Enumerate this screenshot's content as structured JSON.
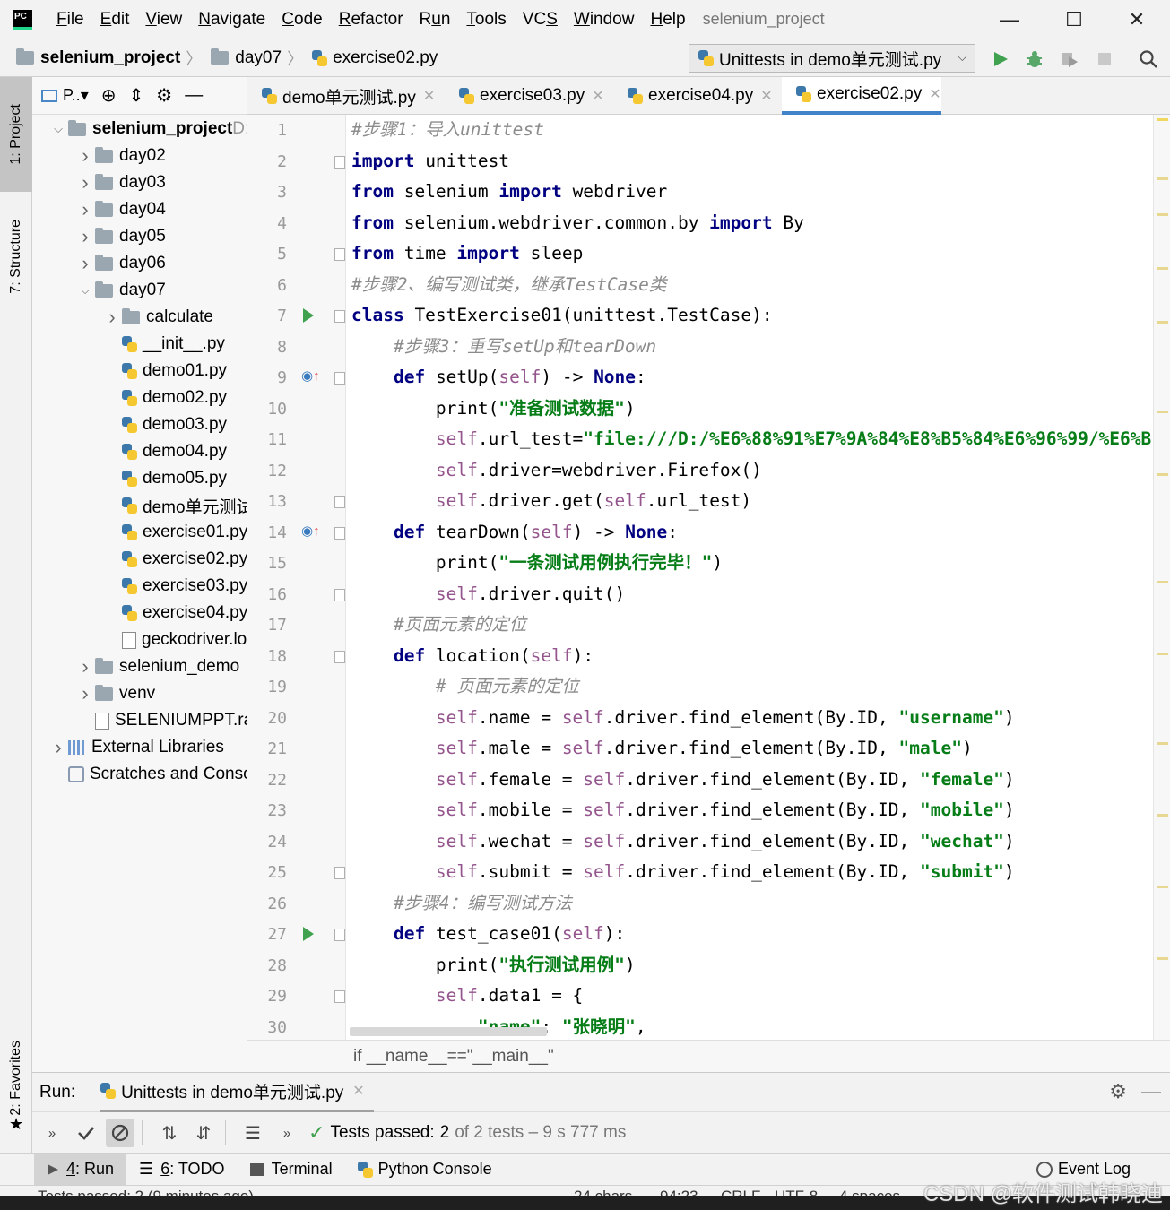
{
  "menubar": {
    "logo": "PC",
    "items": [
      "File",
      "Edit",
      "View",
      "Navigate",
      "Code",
      "Refactor",
      "Run",
      "Tools",
      "VCS",
      "Window",
      "Help"
    ],
    "mnemonics": [
      "F",
      "E",
      "V",
      "N",
      "C",
      "R",
      "u",
      "T",
      "S",
      "W",
      "H"
    ],
    "window_title": "selenium_project",
    "controls": {
      "minimize": "—",
      "maximize": "☐",
      "close": "✕"
    }
  },
  "navbar": {
    "crumbs": [
      "selenium_project",
      "day07",
      "exercise02.py"
    ],
    "run_config": "Unittests in demo单元测试.py",
    "run_config_chevron": "⌵"
  },
  "left_strip": {
    "project_tab": "1: Project",
    "structure_tab": "7: Structure",
    "favorites_tab": "2: Favorites"
  },
  "project_panel": {
    "view_label": "P..▾",
    "tree": [
      {
        "label": "selenium_project",
        "suffix": " D:",
        "type": "folder",
        "depth": 0,
        "expanded": true,
        "bold": true
      },
      {
        "label": "day02",
        "type": "folder",
        "depth": 1,
        "expanded": false
      },
      {
        "label": "day03",
        "type": "folder",
        "depth": 1,
        "expanded": false
      },
      {
        "label": "day04",
        "type": "folder",
        "depth": 1,
        "expanded": false
      },
      {
        "label": "day05",
        "type": "folder",
        "depth": 1,
        "expanded": false
      },
      {
        "label": "day06",
        "type": "folder",
        "depth": 1,
        "expanded": false
      },
      {
        "label": "day07",
        "type": "folder",
        "depth": 1,
        "expanded": true
      },
      {
        "label": "calculate",
        "type": "folder",
        "depth": 2,
        "expanded": false
      },
      {
        "label": "__init__.py",
        "type": "py",
        "depth": 2
      },
      {
        "label": "demo01.py",
        "type": "py",
        "depth": 2
      },
      {
        "label": "demo02.py",
        "type": "py",
        "depth": 2
      },
      {
        "label": "demo03.py",
        "type": "py",
        "depth": 2
      },
      {
        "label": "demo04.py",
        "type": "py",
        "depth": 2
      },
      {
        "label": "demo05.py",
        "type": "py",
        "depth": 2
      },
      {
        "label": "demo单元测试",
        "type": "py",
        "depth": 2
      },
      {
        "label": "exercise01.py",
        "type": "py",
        "depth": 2
      },
      {
        "label": "exercise02.py",
        "type": "py",
        "depth": 2
      },
      {
        "label": "exercise03.py",
        "type": "py",
        "depth": 2
      },
      {
        "label": "exercise04.py",
        "type": "py",
        "depth": 2
      },
      {
        "label": "geckodriver.lo",
        "type": "file",
        "depth": 2
      },
      {
        "label": "selenium_demo",
        "type": "folder",
        "depth": 1,
        "expanded": false
      },
      {
        "label": "venv",
        "type": "folder",
        "depth": 1,
        "expanded": false
      },
      {
        "label": "SELENIUMPPT.rar",
        "type": "file",
        "depth": 1
      },
      {
        "label": "External Libraries",
        "type": "lib",
        "depth": 0,
        "expanded": false
      },
      {
        "label": "Scratches and Consoles",
        "type": "scratch",
        "depth": 0
      }
    ]
  },
  "editor_tabs": [
    {
      "label": "demo单元测试.py",
      "active": false
    },
    {
      "label": "exercise03.py",
      "active": false
    },
    {
      "label": "exercise04.py",
      "active": false
    },
    {
      "label": "exercise02.py",
      "active": true
    }
  ],
  "editor": {
    "lines": [
      [
        [
          "cmt",
          "#步骤1：导入unittest"
        ]
      ],
      [
        [
          "kw",
          "import"
        ],
        [
          "",
          " unittest"
        ]
      ],
      [
        [
          "kw",
          "from"
        ],
        [
          "",
          " selenium "
        ],
        [
          "kw",
          "import"
        ],
        [
          "",
          " webdriver"
        ]
      ],
      [
        [
          "kw",
          "from"
        ],
        [
          "",
          " selenium.webdriver.common.by "
        ],
        [
          "kw",
          "import"
        ],
        [
          "",
          " By"
        ]
      ],
      [
        [
          "kw",
          "from"
        ],
        [
          "",
          " time "
        ],
        [
          "kw",
          "import"
        ],
        [
          "",
          " sleep"
        ]
      ],
      [
        [
          "cmt",
          "#步骤2、编写测试类，继承TestCase类"
        ]
      ],
      [
        [
          "kw",
          "class"
        ],
        [
          "",
          " TestExercise01(unittest.TestCase):"
        ]
      ],
      [
        [
          "",
          "    "
        ],
        [
          "cmt",
          "#步骤3：重写setUp和tearDown"
        ]
      ],
      [
        [
          "",
          "    "
        ],
        [
          "kw",
          "def"
        ],
        [
          "",
          " setUp("
        ],
        [
          "self",
          "self"
        ],
        [
          "",
          ") -> "
        ],
        [
          "kw",
          "None"
        ],
        [
          "",
          ":"
        ]
      ],
      [
        [
          "",
          "        print("
        ],
        [
          "str",
          "\"准备测试数据\""
        ],
        [
          "",
          ")"
        ]
      ],
      [
        [
          "",
          "        "
        ],
        [
          "self",
          "self"
        ],
        [
          "",
          ".url_test="
        ],
        [
          "str",
          "\"file:///D:/%E6%88%91%E7%9A%84%E8%B5%84%E6%96%99/%E6%B"
        ]
      ],
      [
        [
          "",
          "        "
        ],
        [
          "self",
          "self"
        ],
        [
          "",
          ".driver=webdriver.Firefox()"
        ]
      ],
      [
        [
          "",
          "        "
        ],
        [
          "self",
          "self"
        ],
        [
          "",
          ".driver.get("
        ],
        [
          "self",
          "self"
        ],
        [
          "",
          ".url_test)"
        ]
      ],
      [
        [
          "",
          "    "
        ],
        [
          "kw",
          "def"
        ],
        [
          "",
          " tearDown("
        ],
        [
          "self",
          "self"
        ],
        [
          "",
          ") -> "
        ],
        [
          "kw",
          "None"
        ],
        [
          "",
          ":"
        ]
      ],
      [
        [
          "",
          "        print("
        ],
        [
          "str",
          "\"一条测试用例执行完毕！\""
        ],
        [
          "",
          ")"
        ]
      ],
      [
        [
          "",
          "        "
        ],
        [
          "self",
          "self"
        ],
        [
          "",
          ".driver.quit()"
        ]
      ],
      [
        [
          "",
          "    "
        ],
        [
          "cmt",
          "#页面元素的定位"
        ]
      ],
      [
        [
          "",
          "    "
        ],
        [
          "kw",
          "def"
        ],
        [
          "",
          " location("
        ],
        [
          "self",
          "self"
        ],
        [
          "",
          "):"
        ]
      ],
      [
        [
          "",
          "        "
        ],
        [
          "cmt",
          "# 页面元素的定位"
        ]
      ],
      [
        [
          "",
          "        "
        ],
        [
          "self",
          "self"
        ],
        [
          "",
          ".name = "
        ],
        [
          "self",
          "self"
        ],
        [
          "",
          ".driver.find_element(By.ID, "
        ],
        [
          "str",
          "\"username\""
        ],
        [
          "",
          ")"
        ]
      ],
      [
        [
          "",
          "        "
        ],
        [
          "self",
          "self"
        ],
        [
          "",
          ".male = "
        ],
        [
          "self",
          "self"
        ],
        [
          "",
          ".driver.find_element(By.ID, "
        ],
        [
          "str",
          "\"male\""
        ],
        [
          "",
          ")"
        ]
      ],
      [
        [
          "",
          "        "
        ],
        [
          "self",
          "self"
        ],
        [
          "",
          ".female = "
        ],
        [
          "self",
          "self"
        ],
        [
          "",
          ".driver.find_element(By.ID, "
        ],
        [
          "str",
          "\"female\""
        ],
        [
          "",
          ")"
        ]
      ],
      [
        [
          "",
          "        "
        ],
        [
          "self",
          "self"
        ],
        [
          "",
          ".mobile = "
        ],
        [
          "self",
          "self"
        ],
        [
          "",
          ".driver.find_element(By.ID, "
        ],
        [
          "str",
          "\"mobile\""
        ],
        [
          "",
          ")"
        ]
      ],
      [
        [
          "",
          "        "
        ],
        [
          "self",
          "self"
        ],
        [
          "",
          ".wechat = "
        ],
        [
          "self",
          "self"
        ],
        [
          "",
          ".driver.find_element(By.ID, "
        ],
        [
          "str",
          "\"wechat\""
        ],
        [
          "",
          ")"
        ]
      ],
      [
        [
          "",
          "        "
        ],
        [
          "self",
          "self"
        ],
        [
          "",
          ".submit = "
        ],
        [
          "self",
          "self"
        ],
        [
          "",
          ".driver.find_element(By.ID, "
        ],
        [
          "str",
          "\"submit\""
        ],
        [
          "",
          ")"
        ]
      ],
      [
        [
          "",
          "    "
        ],
        [
          "cmt",
          "#步骤4：编写测试方法"
        ]
      ],
      [
        [
          "",
          "    "
        ],
        [
          "kw",
          "def"
        ],
        [
          "",
          " test_case01("
        ],
        [
          "self",
          "self"
        ],
        [
          "",
          "):"
        ]
      ],
      [
        [
          "",
          "        print("
        ],
        [
          "str",
          "\"执行测试用例\""
        ],
        [
          "",
          ")"
        ]
      ],
      [
        [
          "",
          "        "
        ],
        [
          "self",
          "self"
        ],
        [
          "",
          ".data1 = {"
        ]
      ],
      [
        [
          "",
          "            "
        ],
        [
          "str",
          "\"name\""
        ],
        [
          "",
          ": "
        ],
        [
          "str",
          "\"张晓明\""
        ],
        [
          "",
          ","
        ]
      ]
    ],
    "run_marker_lines": [
      7,
      27
    ],
    "override_marker_lines": [
      9,
      14
    ],
    "fold_lines": [
      2,
      5,
      7,
      9,
      13,
      14,
      16,
      18,
      25,
      27,
      29
    ],
    "breadcrumb": "if __name__==\"__main__\""
  },
  "run_panel": {
    "label": "Run:",
    "tab_label": "Unittests in demo单元测试.py",
    "tests_passed_label": "Tests passed:",
    "passed_count": "2",
    "rest": "of 2 tests – 9 s 777 ms"
  },
  "bottom_bar": {
    "run": {
      "num": "4",
      "label": ": Run"
    },
    "todo": {
      "num": "6",
      "label": ": TODO"
    },
    "terminal": "Terminal",
    "python_console": "Python Console",
    "event_log": "Event Log"
  },
  "statusbar": {
    "message": "Tests passed: 2 (9 minutes ago)",
    "chars": "24 chars",
    "position": "94:23",
    "line_sep": "CRLF",
    "encoding": "UTF-8",
    "indent": "4 spaces"
  },
  "watermark": "CSDN @软件测试韩晓迪"
}
